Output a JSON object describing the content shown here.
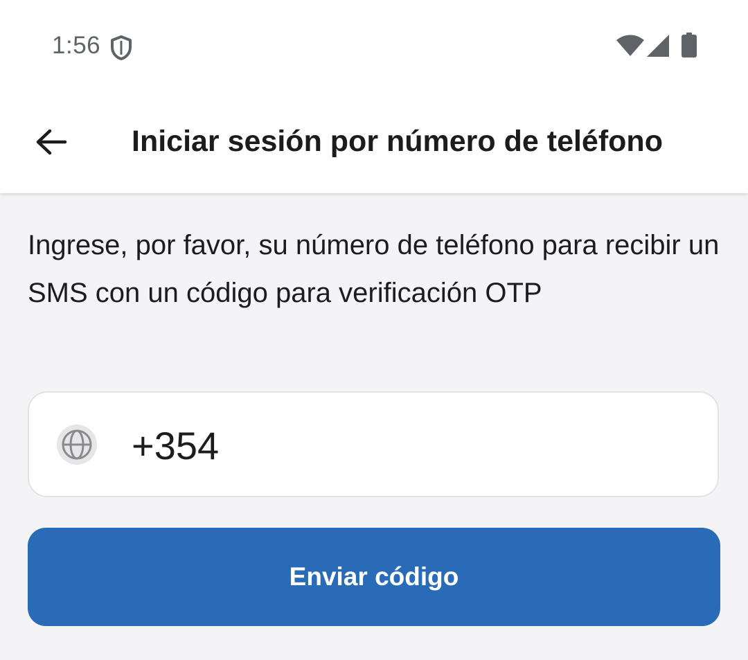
{
  "status_bar": {
    "time": "1:56",
    "icons": [
      "shield-icon",
      "wifi-icon",
      "cell-signal-icon",
      "battery-icon"
    ]
  },
  "app_bar": {
    "back_icon": "arrow-left-icon",
    "title": "Iniciar sesión por número de teléfono"
  },
  "main": {
    "description": "Ingrese, por favor, su número de teléfono para recibir un SMS con un código para verificación OTP",
    "phone_field": {
      "country_icon": "globe-icon",
      "value": "+354",
      "placeholder": ""
    },
    "send_button_label": "Enviar código"
  },
  "colors": {
    "primary": "#2a6bb8",
    "background": "#f4f4f6",
    "surface": "#ffffff",
    "text": "#1c1c1e",
    "status_text": "#5f6368"
  }
}
